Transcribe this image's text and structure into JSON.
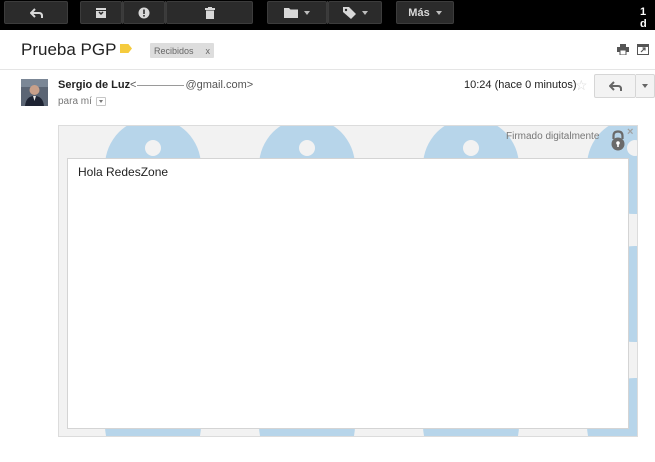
{
  "toolbar": {
    "back_icon": "back-arrow-icon",
    "archive_icon": "archive-icon",
    "spam_icon": "report-spam-icon",
    "delete_icon": "trash-icon",
    "move_icon": "folder-icon",
    "labels_icon": "label-tag-icon",
    "more_label": "Más",
    "right_text": "1 d"
  },
  "message": {
    "subject": "Prueba PGP",
    "label_chip": "Recibidos",
    "label_chip_close": "x",
    "sender_name": "Sergio de Luz",
    "sender_email_start": "<",
    "sender_email_end": "@gmail.com>",
    "recipients": "para mí",
    "timestamp": "10:24 (hace 0 minutos)",
    "signature_status": "Firmado digitalmente",
    "signature_close": "×",
    "body": "Hola RedesZone"
  },
  "colors": {
    "toolbar_bg": "#000000",
    "button_bg": "#2b2b2b",
    "label_yellow": "#f5cb3e",
    "pattern_blue": "#b7d5ea"
  }
}
